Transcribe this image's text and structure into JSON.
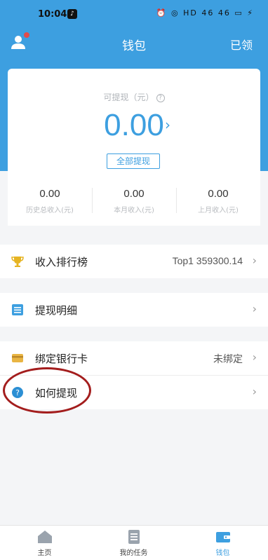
{
  "status_bar": {
    "time": "10:04",
    "app_badge": "♪",
    "system": "⏰ ◎ HD 46 46 ▭ ⚡"
  },
  "header": {
    "title": "钱包",
    "right_action": "已领"
  },
  "balance": {
    "label": "可提现（元）",
    "help": "?",
    "amount": "0.00",
    "chevron": "›",
    "withdraw_all": "全部提现"
  },
  "stats": [
    {
      "value": "0.00",
      "label": "历史总收入(元)"
    },
    {
      "value": "0.00",
      "label": "本月收入(元)"
    },
    {
      "value": "0.00",
      "label": "上月收入(元)"
    }
  ],
  "menu": {
    "ranking": {
      "label": "收入排行榜",
      "value": "Top1 359300.14",
      "icon": "trophy-icon"
    },
    "details": {
      "label": "提现明细",
      "icon": "list-icon"
    },
    "bank_card": {
      "label": "绑定银行卡",
      "value": "未绑定",
      "icon": "card-icon"
    },
    "how_to": {
      "label": "如何提现",
      "icon": "help-icon"
    },
    "chevron": "›"
  },
  "nav": [
    {
      "label": "主页",
      "icon": "home-icon"
    },
    {
      "label": "我的任务",
      "icon": "task-icon"
    },
    {
      "label": "钱包",
      "icon": "wallet-icon",
      "active": true
    }
  ],
  "colors": {
    "primary": "#3d9fe0",
    "annotation": "#a31d1d",
    "trophy": "#e6b422"
  }
}
